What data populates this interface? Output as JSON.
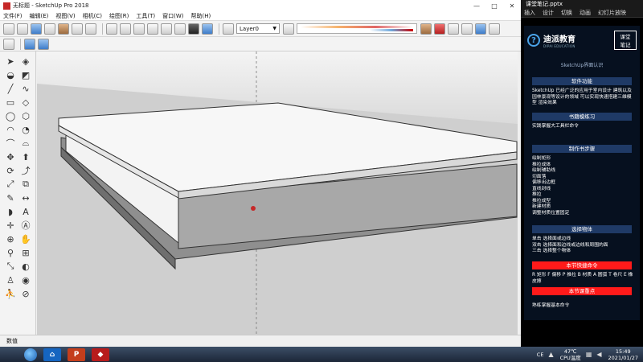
{
  "sketchup": {
    "title": "无标题 - SketchUp Pro 2018",
    "window_controls": [
      "—",
      "□",
      "✕"
    ],
    "menu": [
      "文件(F)",
      "编辑(E)",
      "视图(V)",
      "相机(C)",
      "绘图(R)",
      "工具(T)",
      "窗口(W)",
      "帮助(H)"
    ],
    "layer": "Layer0",
    "status_text": "数值"
  },
  "ppt": {
    "title": "课堂笔记.pptx",
    "tabs": [
      "插入",
      "设计",
      "切换",
      "动画",
      "幻灯片放映"
    ],
    "brand_name": "迪派教育",
    "brand_sub": "DIPAI EDUCATION",
    "course_badge": [
      "课堂",
      "笔记"
    ],
    "heading": "SketchUp界面认识",
    "sections": {
      "software_function": {
        "title": "软件功能",
        "text": "SketchUp 已经广泛的应用于室内设计 建筑以及园林景观等设计的领域 可以实现快速搭建三维模型 渲染效果"
      },
      "practice": {
        "title": "书籍模练习",
        "text": "实践掌握大工具栏命令"
      },
      "steps": {
        "title": "制作书步骤",
        "items": [
          "绘制矩形",
          "推拉成体",
          "绘制辅助线",
          "切面落",
          "偏移出边框",
          "直线封线",
          "推拉",
          "推拉成型",
          "新建材质",
          "调整材质位置固定"
        ]
      },
      "select": {
        "title": "选择物体",
        "items": [
          "单击 选择面或边线",
          "双击 选择面和边线或边线和周围的面",
          "三击 选择整个物体"
        ]
      },
      "shortcuts": {
        "title": "本节快捷命令",
        "text": "R 矩形  F 偏移  P 推拉  B 材质  A 圆弧  T 卷尺  E 橡皮擦"
      },
      "key_point": {
        "title": "本节课重点",
        "text": "熟练掌握基本命令"
      }
    }
  },
  "taskbar": {
    "lang": "CE",
    "temp": "47℃",
    "cpu": "CPU温度",
    "time": "15:49",
    "date": "2021/01/27"
  }
}
